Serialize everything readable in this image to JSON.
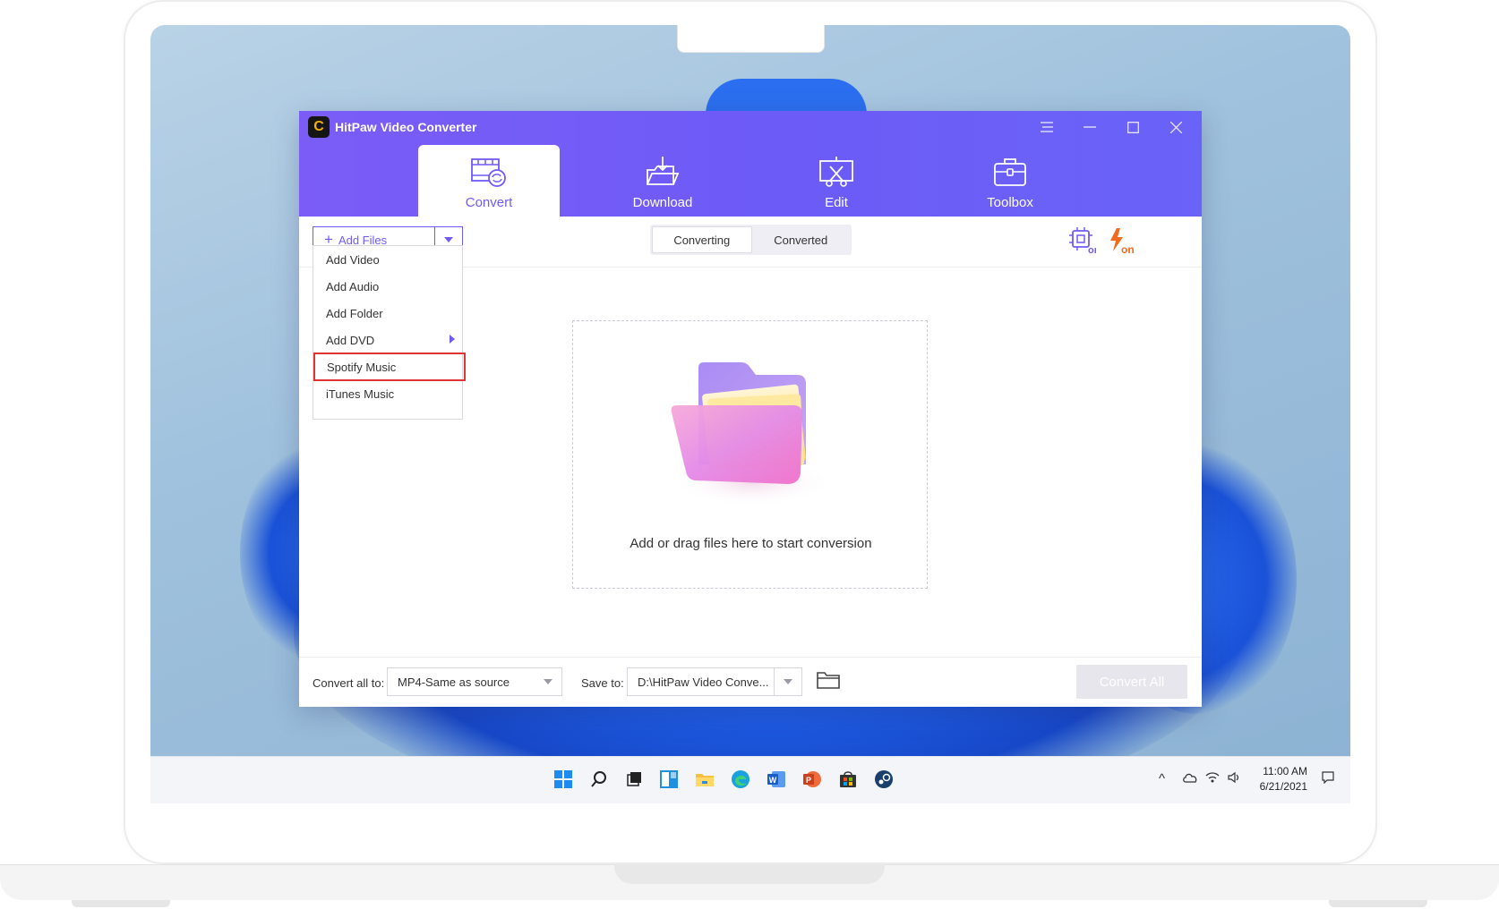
{
  "app": {
    "title": "HitPaw Video Converter",
    "logo_letter": "C",
    "window_controls": [
      "menu-icon",
      "minimize-icon",
      "maximize-icon",
      "close-icon"
    ],
    "accent_color": "#6f5bf6",
    "header_gradient": [
      "#7b5cf7",
      "#6a63f8"
    ]
  },
  "nav": {
    "tabs": [
      {
        "label": "Convert",
        "icon": "convert-film-icon",
        "active": true
      },
      {
        "label": "Download",
        "icon": "download-icon",
        "active": false
      },
      {
        "label": "Edit",
        "icon": "edit-scissors-icon",
        "active": false
      },
      {
        "label": "Toolbox",
        "icon": "toolbox-icon",
        "active": false
      }
    ]
  },
  "toolbar": {
    "add_files_plus": "+",
    "add_files_label": "Add Files",
    "segments": [
      "Converting",
      "Converted"
    ],
    "active_segment": "Converting",
    "hw_accel_label": "on",
    "lightning_label": "on"
  },
  "dropdown": {
    "items": [
      {
        "label": "Add Video"
      },
      {
        "label": "Add Audio"
      },
      {
        "label": "Add Folder"
      },
      {
        "label": "Add DVD",
        "has_submenu": true
      },
      {
        "label": "Spotify Music",
        "highlighted": true
      },
      {
        "label": "iTunes Music"
      }
    ]
  },
  "dropzone": {
    "text": "Add or drag files here to start conversion",
    "icon": "folder-icon"
  },
  "footer": {
    "convert_all_label": "Convert all to:",
    "format_value": "MP4-Same as source",
    "save_to_label": "Save to:",
    "path_value": "D:\\HitPaw Video Conve...",
    "convert_all_button": "Convert All"
  },
  "taskbar": {
    "icons": [
      "windows-start-icon",
      "search-icon",
      "task-view-icon",
      "widgets-icon",
      "file-explorer-icon",
      "edge-icon",
      "word-icon",
      "powerpoint-icon",
      "store-icon",
      "steam-icon"
    ],
    "time": "11:00 AM",
    "date": "6/21/2021"
  }
}
